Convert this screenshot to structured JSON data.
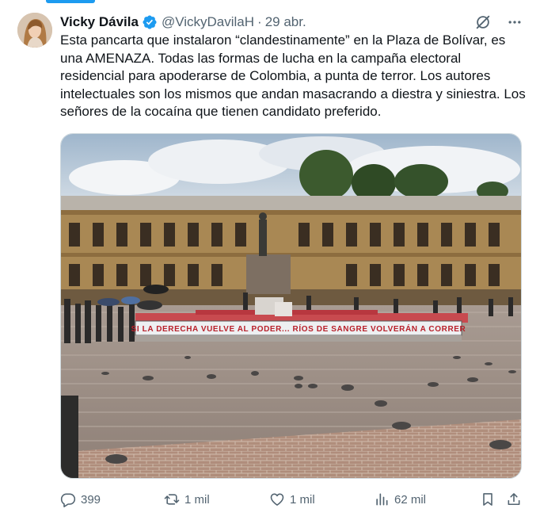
{
  "tweet": {
    "author": {
      "display_name": "Vicky Dávila",
      "verified": true,
      "handle": "@VickyDavilaH",
      "separator": "·",
      "date": "29 abr."
    },
    "text": "Esta pancarta que instalaron “clandestinamente” en la Plaza de Bolívar, es una AMENAZA. Todas las formas de lucha en la campaña electoral residencial para apoderarse de Colombia, a punta de terror. Los autores intelectuales son los mismos que andan masacrando a diestra y siniestra. Los señores de la cocaína que tienen candidato preferido.",
    "image": {
      "banner_text": "SI LA DERECHA VUELVE AL PODER... RÍOS DE SANGRE VOLVERÁN A CORRER"
    },
    "stats": {
      "replies": "399",
      "retweets": "1 mil",
      "likes": "1 mil",
      "views": "62 mil"
    },
    "icons": {
      "header": [
        "grok-icon",
        "more-icon"
      ],
      "actions": [
        "reply-icon",
        "retweet-icon",
        "like-icon",
        "views-icon",
        "bookmark-icon",
        "share-icon"
      ]
    },
    "colors": {
      "accent": "#1d9bf0",
      "text": "#0f1419",
      "muted": "#536471",
      "border": "#cfd9de"
    }
  }
}
